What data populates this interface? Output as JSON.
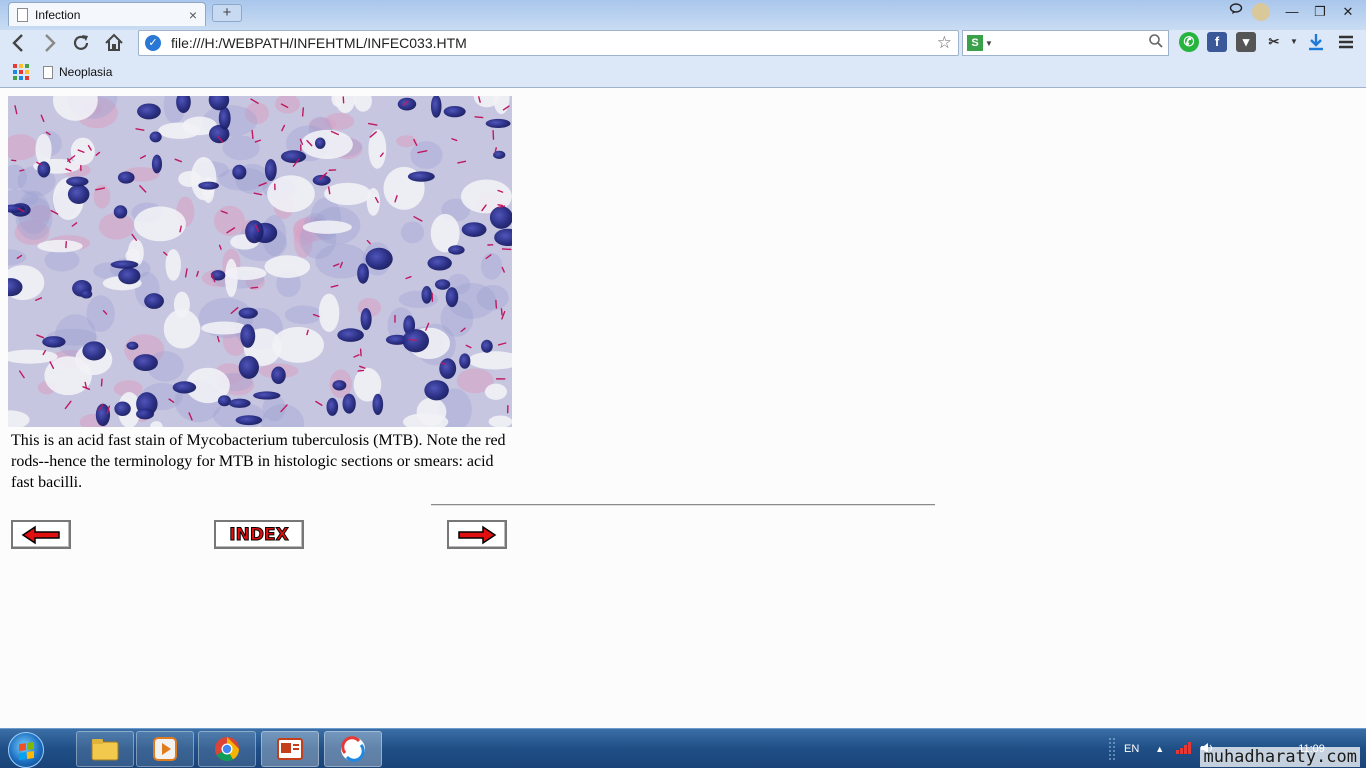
{
  "browser": {
    "tab_title": "Infection",
    "tab_close": "×",
    "new_tab": "+",
    "url": "file:///H:/WEBPATH/INFEHTML/INFEC033.HTM",
    "bookmarks": [
      {
        "label": "Neoplasia"
      }
    ],
    "window_controls": {
      "minimize": "—",
      "restore": "❐",
      "close": "✕"
    },
    "nav": {
      "back": "‹",
      "forward": "›",
      "reload": "↻",
      "home": "⌂"
    },
    "search_engine_badge": "S",
    "icons": [
      "back-icon",
      "forward-icon",
      "reload-icon",
      "home-icon",
      "secure-icon",
      "star-icon",
      "search-icon",
      "whatsapp-icon",
      "facebook-icon",
      "download-ext-icon",
      "scissors-icon",
      "download-icon",
      "menu-icon"
    ]
  },
  "page": {
    "caption": "This is an acid fast stain of Mycobacterium tuberculosis (MTB). Note the red rods--hence the terminology for MTB in histologic sections or smears: acid fast bacilli.",
    "nav_buttons": {
      "index_label": "INDEX"
    }
  },
  "taskbar": {
    "language": "EN",
    "time": "11:09",
    "apps": [
      "file-explorer-icon",
      "media-player-icon",
      "chrome-icon",
      "powerpoint-icon",
      "app-icon"
    ]
  },
  "watermark": "muhadharaty.com",
  "colors": {
    "chrome_bg": "#dce8f7",
    "stain_red": "#c01860",
    "stain_blue": "#2a2f8f",
    "arrow_red": "#e01010"
  }
}
